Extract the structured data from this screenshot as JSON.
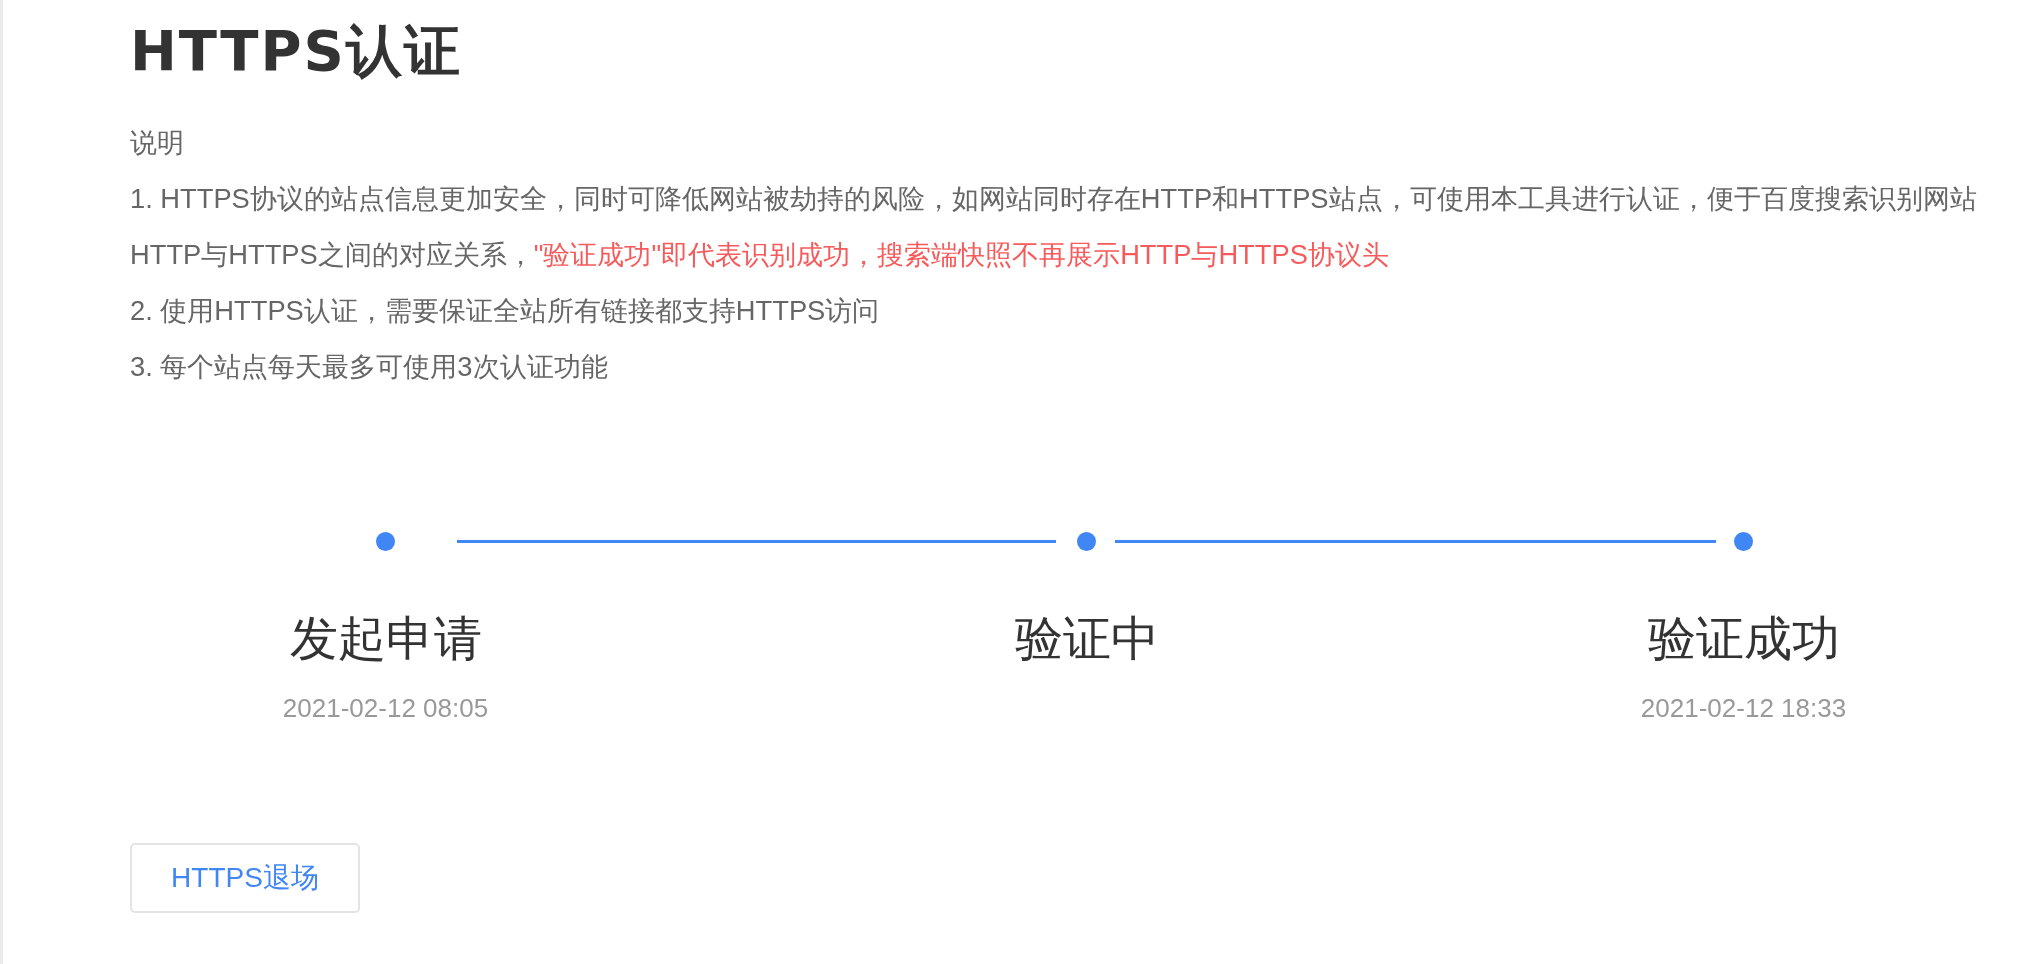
{
  "title": "HTTPS认证",
  "notes": {
    "heading": "说明",
    "items": [
      {
        "segments": [
          {
            "text": "1. HTTPS协议的站点信息更加安全，同时可降低网站被劫持的风险，如网站同时存在HTTP和HTTPS站点，可使用本工具进行认证，便于百度搜索识别网站HTTP与HTTPS之间的对应关系，",
            "emphasis": false
          },
          {
            "text": "\"验证成功\"即代表识别成功，搜索端快照不再展示HTTP与HTTPS协议头",
            "emphasis": true
          }
        ]
      },
      {
        "segments": [
          {
            "text": "2. 使用HTTPS认证，需要保证全站所有链接都支持HTTPS访问",
            "emphasis": false
          }
        ]
      },
      {
        "segments": [
          {
            "text": "3. 每个站点每天最多可使用3次认证功能",
            "emphasis": false
          }
        ]
      }
    ]
  },
  "steps": [
    {
      "label": "发起申请",
      "time": "2021-02-12 08:05",
      "done": true
    },
    {
      "label": "验证中",
      "done": true
    },
    {
      "label": "验证成功",
      "time": "2021-02-12 18:33",
      "done": true
    }
  ],
  "button": {
    "label": "HTTPS退场"
  }
}
